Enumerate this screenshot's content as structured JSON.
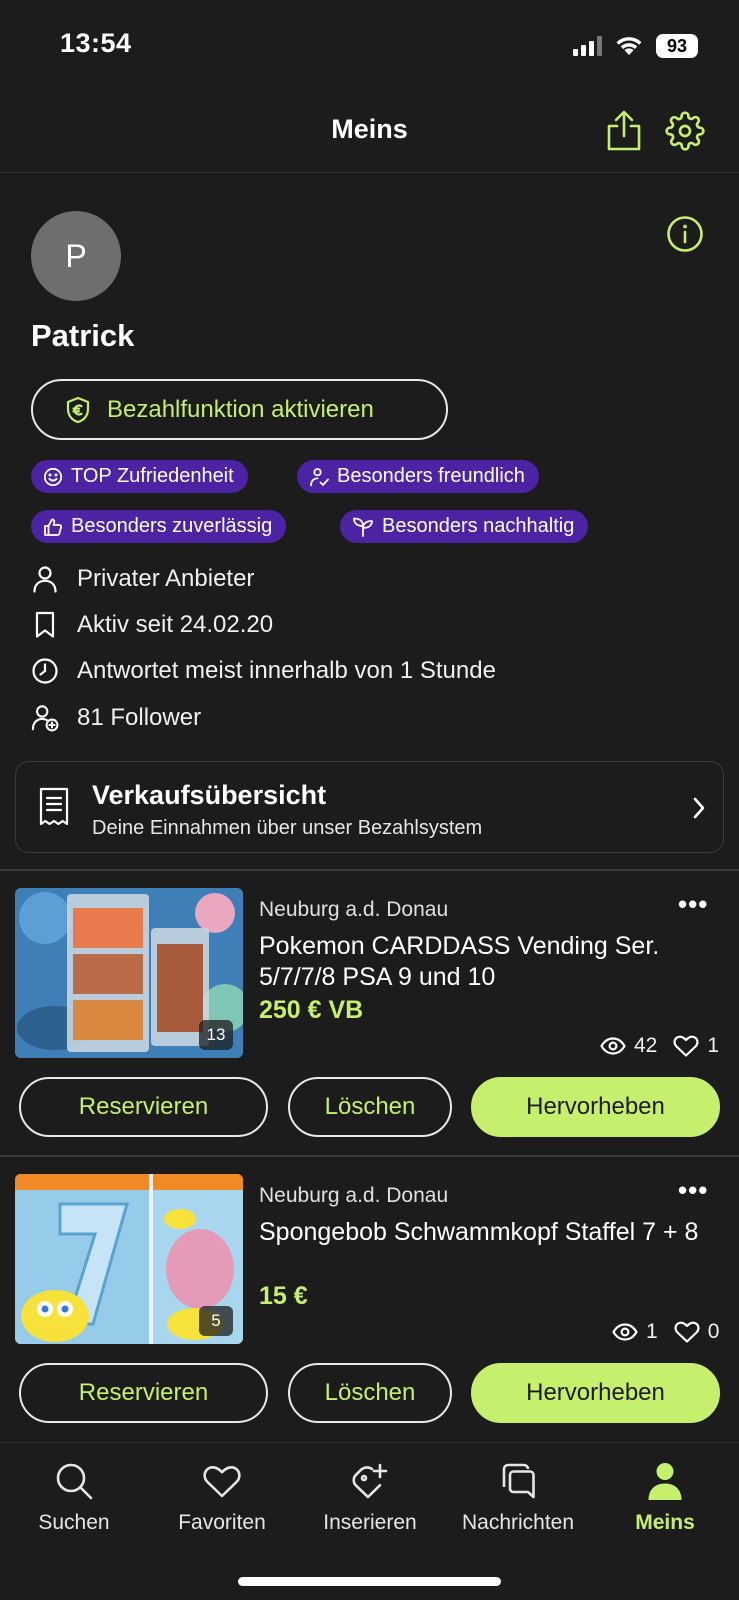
{
  "status_bar": {
    "time": "13:54",
    "battery": "93"
  },
  "header": {
    "title": "Meins",
    "share_icon": "share-icon",
    "settings_icon": "gear-icon"
  },
  "profile": {
    "avatar_initial": "P",
    "name": "Patrick",
    "pay_button_label": "Bezahlfunktion aktivieren",
    "badges": [
      "TOP Zufriedenheit",
      "Besonders freundlich",
      "Besonders zuverlässig",
      "Besonders nachhaltig"
    ],
    "info": [
      "Privater Anbieter",
      "Aktiv seit 24.02.20",
      "Antwortet meist innerhalb von 1 Stunde",
      "81 Follower"
    ]
  },
  "sales_overview": {
    "title": "Verkaufsübersicht",
    "subtitle": "Deine Einnahmen über unser Bezahlsystem"
  },
  "listings": [
    {
      "location": "Neuburg a.d. Donau",
      "title": "Pokemon CARDDASS Vending Ser. 5/7/7/8 PSA 9 und 10",
      "price": "250 € VB",
      "image_count": "13",
      "views": "42",
      "likes": "1",
      "more": "•••",
      "buttons": {
        "reserve": "Reservieren",
        "delete": "Löschen",
        "highlight": "Hervorheben"
      }
    },
    {
      "location": "Neuburg a.d. Donau",
      "title": "Spongebob Schwammkopf Staffel 7 + 8",
      "price": "15 €",
      "image_count": "5",
      "views": "1",
      "likes": "0",
      "more": "•••",
      "buttons": {
        "reserve": "Reservieren",
        "delete": "Löschen",
        "highlight": "Hervorheben"
      }
    }
  ],
  "bottom_nav": [
    {
      "label": "Suchen",
      "icon": "search-icon"
    },
    {
      "label": "Favoriten",
      "icon": "heart-icon"
    },
    {
      "label": "Inserieren",
      "icon": "tag-plus-icon"
    },
    {
      "label": "Nachrichten",
      "icon": "chat-icon"
    },
    {
      "label": "Meins",
      "icon": "person-icon",
      "active": true
    }
  ],
  "colors": {
    "background": "#1c1c1c",
    "accent": "#c6ef6e",
    "badge": "#4b23a3"
  }
}
